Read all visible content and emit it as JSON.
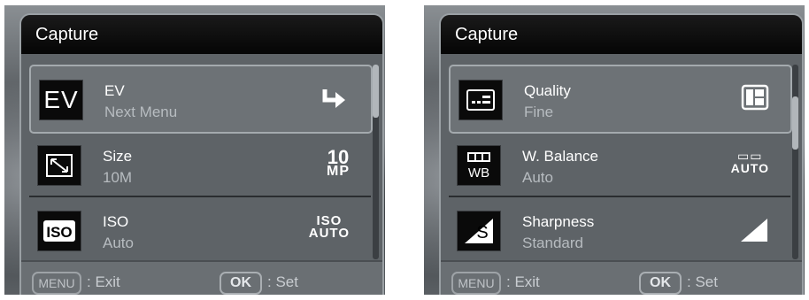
{
  "left_screen": {
    "title": "Capture",
    "items": [
      {
        "label": "EV",
        "value": "Next Menu",
        "icon": "ev-icon",
        "right_icon": "next-arrow-icon",
        "selected": true
      },
      {
        "label": "Size",
        "value": "10M",
        "icon": "size-icon",
        "right_top": "10",
        "right_bottom": "MP"
      },
      {
        "label": "ISO",
        "value": "Auto",
        "icon": "iso-icon",
        "right_top": "ISO",
        "right_bottom": "AUTO"
      }
    ],
    "footer": {
      "menu_key": "MENU",
      "exit_text": ": Exit",
      "ok_key": "OK",
      "set_text": ": Set"
    }
  },
  "right_screen": {
    "title": "Capture",
    "items": [
      {
        "label": "Quality",
        "value": "Fine",
        "icon": "quality-icon",
        "right_icon": "fine-quality-icon",
        "selected": true
      },
      {
        "label": "W. Balance",
        "value": "Auto",
        "icon": "white-balance-icon",
        "right_top": "▭▭",
        "right_bottom": "AUTO"
      },
      {
        "label": "Sharpness",
        "value": "Standard",
        "icon": "sharpness-icon",
        "right_icon": "standard-sharpness-icon"
      }
    ],
    "footer": {
      "menu_key": "MENU",
      "exit_text": ": Exit",
      "ok_key": "OK",
      "set_text": ": Set"
    }
  },
  "colors": {
    "title_bg": "#0a0a0a",
    "panel_bg": "#5e6367",
    "value_text": "#b7bcc0"
  }
}
